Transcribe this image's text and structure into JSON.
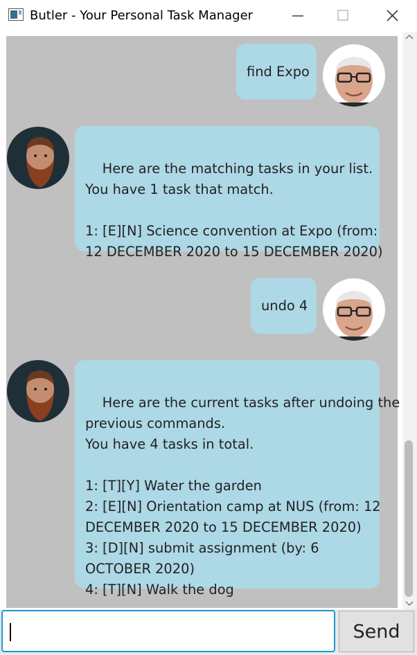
{
  "window": {
    "title": "Butler - Your Personal Task Manager",
    "controls": [
      "minimize",
      "maximize",
      "close"
    ]
  },
  "conversation": [
    {
      "sender": "user",
      "text": "find Expo"
    },
    {
      "sender": "bot",
      "text": "Here are the matching tasks in your list.\nYou have 1 task that match.\n\n1: [E][N] Science convention at Expo (from:\n12 DECEMBER 2020 to 15 DECEMBER 2020)"
    },
    {
      "sender": "user",
      "text": "undo 4"
    },
    {
      "sender": "bot",
      "text": "Here are the current tasks after undoing the\nprevious commands.\nYou have 4 tasks in total.\n\n1: [T][Y] Water the garden\n2: [E][N] Orientation camp at NUS (from: 12\nDECEMBER 2020 to 15 DECEMBER 2020)\n3: [D][N] submit assignment (by: 6\nOCTOBER 2020)\n4: [T][N] Walk the dog"
    }
  ],
  "input": {
    "value": "",
    "placeholder": ""
  },
  "send_label": "Send",
  "colors": {
    "bubble": "#add8e6",
    "chat_background": "#c0c0c0",
    "input_focus": "#1e96d6"
  },
  "icons": {
    "app": "window-app-icon",
    "user_avatar": "user-avatar-icon",
    "bot_avatar": "butler-avatar-icon"
  }
}
